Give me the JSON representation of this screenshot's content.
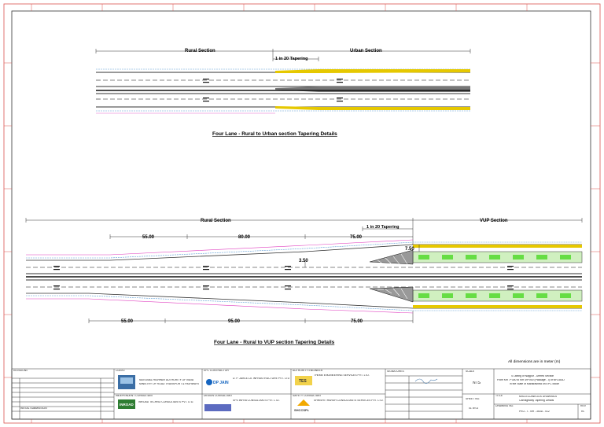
{
  "drawing": {
    "top": {
      "rural_label": "Rural Section",
      "urban_label": "Urban Section",
      "taper_label": "1 in 20 Tapering",
      "title": "Four Lane - Rural to Urban section Tapering Details"
    },
    "bottom": {
      "rural_label": "Rural Section",
      "vup_label": "VUP Section",
      "taper_label": "1 in 20 Tapering",
      "dims_top": [
        "55.00",
        "80.00",
        "75.00"
      ],
      "dims_bottom": [
        "55.00",
        "95.00",
        "75.00"
      ],
      "dim_750": "7.50",
      "dim_350": "3.50",
      "title": "Four Lane - Rural to VUP section Tapering Details"
    },
    "note": "All dimensions are in meter (m)"
  },
  "title_block": {
    "revisions_header": "REVISIONS",
    "initial_submission": "INITIAL SUBMISSION",
    "client_label": "CLIENT",
    "client_name_1": "NATIONAL HIGHWAY AUTHORITY OF INDIA",
    "client_name_2": "MINISTRY OF ROAD TRANSPORT & HIGHWAYS",
    "consultant_label": "INDEPENDENT CONSULTANT",
    "consultant_name": "INROAD TECHNO CONSULTANTS PVT. LTD.",
    "consultant_logo": "INROAD",
    "epc_label": "EPC CONTRACTOR",
    "epc_name": "D. P. JAIN & Co. INFRASTRUCTURE PVT. LTD.",
    "epc_logo": "DP JAIN",
    "design_label": "DESIGN CONSULTANT",
    "design_name": "SPS INFRA CONSULTANTS PVT. LTD.",
    "authority_label": "AUTHORITY ENGINEER",
    "authority_name": "THEME ENGINEERING SERVICES PVT. LTD.",
    "authority_logo": "TES",
    "safety_label": "SAFETY CONSULTANT",
    "safety_name": "SHRISHTI HARSH CONSULTANTS SERVICES PVT. LTD.",
    "safety_logo": "SHCCSPL",
    "signatures_label": "SIGNATURES",
    "scale_label": "SCALE",
    "scale_value": "NTS",
    "sheet_no_label": "SHEET NO.",
    "sheet_no_value": "01 of 01",
    "project_1": "4 Laning of Nagpur - Umred Section",
    "project_2": "From Km 7+300 to Km 49+000 (Package - I) of NH-353D",
    "project_3": "in the State of Maharashtra on EPC Mode",
    "drawing_title_label": "TITLE",
    "drawing_title_1": "MISCELLANEOUS DRAWINGS",
    "drawing_title_2": "Carriageway Tapering Details",
    "drawing_no_label": "DRAWING NO.",
    "drawing_no": "PKG - I - NH - 353D - 012",
    "rev_label": "REV",
    "rev_value": "R0"
  },
  "colors": {
    "border": "#d9534f",
    "edge_blue": "#5b9bd5",
    "edge_magenta": "#e040c0",
    "median_green": "#66dd44",
    "kerb_yellow": "#e6c800"
  }
}
